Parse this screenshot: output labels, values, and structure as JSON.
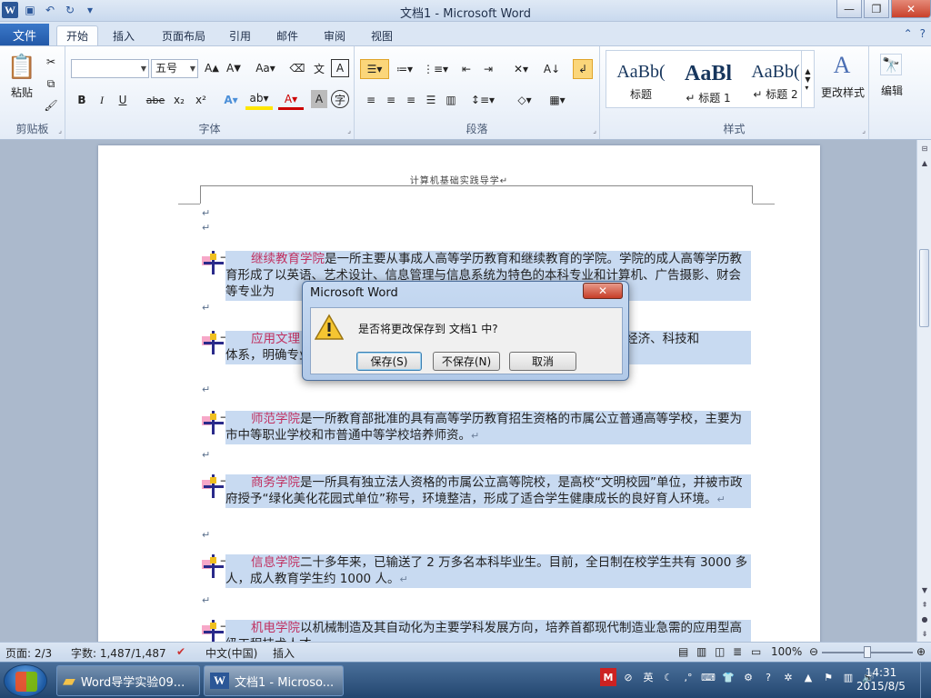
{
  "window": {
    "title": "文档1  -  Microsoft Word",
    "qat": [
      "save-icon",
      "undo-icon",
      "redo-icon",
      "customize-icon"
    ]
  },
  "tabs": {
    "file": "文件",
    "items": [
      "开始",
      "插入",
      "页面布局",
      "引用",
      "邮件",
      "审阅",
      "视图"
    ],
    "active": 0
  },
  "ribbon": {
    "clipboard": {
      "label": "剪贴板",
      "paste": "粘贴"
    },
    "font": {
      "label": "字体",
      "font_name": "",
      "font_size": "五号",
      "buttons": [
        "B",
        "I",
        "U",
        "abe",
        "x₂",
        "x²"
      ]
    },
    "paragraph": {
      "label": "段落"
    },
    "styles": {
      "label": "样式",
      "items": [
        {
          "sample": "AaBb(",
          "name": "标题"
        },
        {
          "sample": "AaBl",
          "name": "↵ 标题 1"
        },
        {
          "sample": "AaBb(",
          "name": "↵ 标题 2"
        }
      ],
      "change": "更改样式"
    },
    "edit": {
      "label": "编辑"
    }
  },
  "document": {
    "header": "计算机基础实践导学↵",
    "paragraphs": [
      {
        "name": "继续教育学院",
        "text": "是一所主要从事成人高等学历教育和继续教育的学院。学院的成人高等学历教育形成了以英语、艺术设计、信息管理与信息系统为特色的本科专业和计算机、广告摄影、财会等专业为",
        "end": ""
      },
      {
        "name": "应用文理",
        "text": "                                                    二十几年来，根据首都经济、科技和                                                     体系，明确专业方向，使毕业生具有",
        "end": ""
      },
      {
        "name": "师范学院",
        "text": "是一所教育部批准的具有高等学历教育招生资格的市属公立普通高等学校，主要为市中等职业学校和市普通中等学校培养师资。",
        "end": "↵"
      },
      {
        "name": "商务学院",
        "text": "是一所具有独立法人资格的市属公立高等院校，是高校“文明校园”单位，并被市政府授予“绿化美化花园式单位”称号，环境整洁，形成了适合学生健康成长的良好育人环境。",
        "end": "↵"
      },
      {
        "name": "信息学院",
        "text": "二十多年来，已输送了 2 万多名本科毕业生。目前，全日制在校学生共有 3000 多人，成人教育学生约 1000 人。",
        "end": "↵"
      },
      {
        "name": "机电学院",
        "text": "以机械制造及其自动化为主要学科发展方向，培养首都现代制造业急需的应用型高级工程技术人才。",
        "end": "↵"
      }
    ]
  },
  "dialog": {
    "title": "Microsoft Word",
    "close": "✕",
    "message": "是否将更改保存到 文档1 中?",
    "buttons": {
      "save": "保存(S)",
      "dont_save": "不保存(N)",
      "cancel": "取消"
    }
  },
  "statusbar": {
    "page": "页面: 2/3",
    "words": "字数: 1,487/1,487",
    "language": "中文(中国)",
    "mode": "插入",
    "zoom": "100%"
  },
  "taskbar": {
    "items": [
      {
        "label": "Word导学实验09...",
        "icon": "folder-icon"
      },
      {
        "label": "文档1 - Microso...",
        "icon": "word-icon"
      }
    ],
    "tray_ime": "英",
    "time": "14:31",
    "date": "2015/8/5"
  }
}
